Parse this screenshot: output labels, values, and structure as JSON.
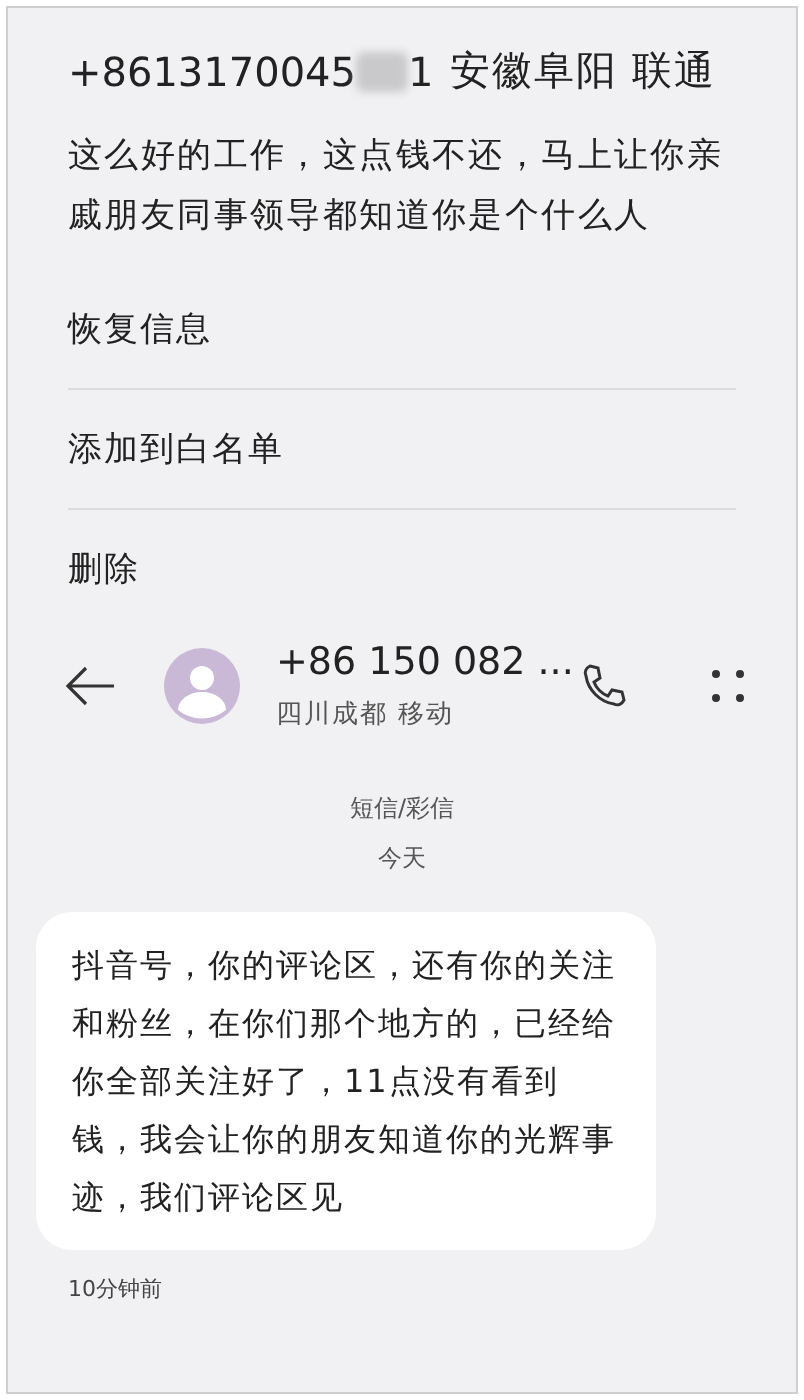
{
  "sender_header": {
    "number_start": "+8613170045",
    "number_end": "1",
    "location": "安徽阜阳 联通"
  },
  "preview_message": "这么好的工作，这点钱不还，马上让你亲戚朋友同事领导都知道你是个什么人",
  "menu_items": [
    "恢复信息",
    "添加到白名单",
    "删除"
  ],
  "conversation": {
    "contact_number": "+86 150 082 ...",
    "contact_location": "四川成都 移动"
  },
  "message_type": "短信/彩信",
  "date_label": "今天",
  "messages": [
    {
      "text": "抖音号，你的评论区，还有你的关注和粉丝，在你们那个地方的，已经给你全部关注好了，11点没有看到钱，我会让你的朋友知道你的光辉事迹，我们评论区见",
      "time": "10分钟前"
    }
  ]
}
